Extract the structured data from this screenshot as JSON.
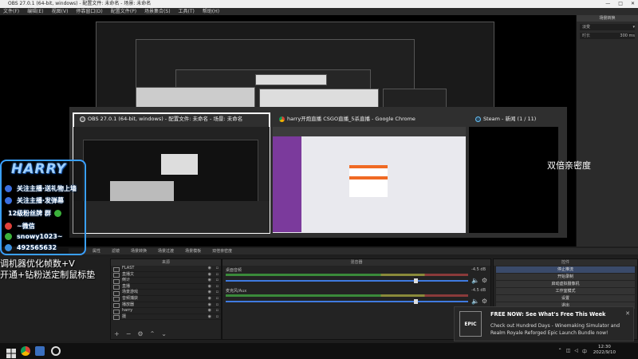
{
  "window": {
    "title": "OBS 27.0.1 (64-bit, windows) - 配置文件: 未命名 - 场景: 未命名",
    "controls": [
      "—",
      "□",
      "✕"
    ]
  },
  "menu": [
    "文件(F)",
    "编辑(E)",
    "视图(V)",
    "停靠窗口(D)",
    "配置文件(P)",
    "场景集合(S)",
    "工具(T)",
    "帮助(H)"
  ],
  "transitions": {
    "header": "场景转换",
    "type": "淡变",
    "duration_label": "时长",
    "duration_value": "300 ms"
  },
  "switcher": {
    "windows": [
      {
        "title": "OBS 27.0.1 (64-bit, windows) - 配置文件: 未命名 - 场景: 未命名",
        "icon": "obs-icon"
      },
      {
        "title": "harry开炮直播 CSGO直播_5杀直播 - Google Chrome",
        "icon": "chrome-icon"
      },
      {
        "title": "Steam - 新闻 (1 / 11)",
        "icon": "steam-icon"
      }
    ]
  },
  "dock_tabs": [
    "属性",
    "滤镜",
    "场景转换",
    "场景过渡",
    "场景模板",
    "双倍亲密度"
  ],
  "docks": {
    "sources": {
      "header": "来源",
      "items": [
        "FLAST",
        "直播文",
        "倒计",
        "直播",
        "场景游戏",
        "音频捕获",
        "播放器",
        "harry",
        "摄"
      ]
    },
    "mixer": {
      "header": "混音器",
      "channels": [
        {
          "name": "桌面音频",
          "db": "-4.5 dB"
        },
        {
          "name": "麦克风/Aux",
          "db": "-4.5 dB"
        }
      ]
    },
    "controls": {
      "header": "控件",
      "buttons": [
        "停止推流",
        "开始录制",
        "启动虚拟摄像机",
        "工作室模式",
        "设置",
        "退出"
      ]
    }
  },
  "overlay": {
    "title": "HARRY",
    "lines": [
      "关注主播·送礼物上墙",
      "关注主播·发弹幕",
      "12级粉丝牌 群",
      "~微信",
      "snowy1023~",
      "492565632"
    ],
    "side_text_1": "调机器优化帧数+V",
    "side_text_2": "开通+钻粉送定制鼠标垫"
  },
  "chat_text": "双倍亲密度",
  "notification": {
    "logo": "EPIC",
    "title": "FREE NOW: See What's Free This Week",
    "body": "Check out Hundred Days - Winemaking Simulator and Realm Royale Reforged Epic Launch Bundle now!",
    "close": "✕"
  },
  "taskbar": {
    "time": "12:30",
    "date": "2022/9/10",
    "lang": "中"
  }
}
